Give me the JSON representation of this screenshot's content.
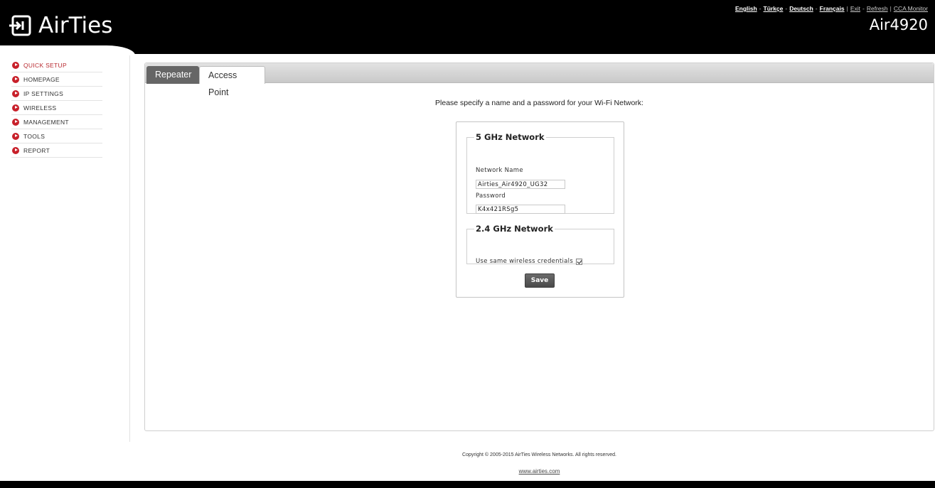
{
  "header": {
    "brand": "AirTies",
    "model": "Air4920",
    "languages": [
      "English",
      "Türkçe",
      "Deutsch",
      "Français"
    ],
    "links": [
      "Exit",
      "Refresh",
      "CCA Monitor"
    ]
  },
  "sidebar": {
    "items": [
      {
        "label": "QUICK SETUP",
        "active": true
      },
      {
        "label": "HOMEPAGE"
      },
      {
        "label": "IP SETTINGS"
      },
      {
        "label": "WIRELESS"
      },
      {
        "label": "MANAGEMENT"
      },
      {
        "label": "TOOLS"
      },
      {
        "label": "REPORT"
      }
    ]
  },
  "tabs": [
    {
      "label": "Repeater"
    },
    {
      "label": "Access Point",
      "selected": true
    }
  ],
  "main": {
    "instruction": "Please specify a name and a password for your Wi-Fi Network:",
    "network_5g": {
      "legend": "5 GHz Network",
      "name_label": "Network Name",
      "name_value": "Airties_Air4920_UG32",
      "password_label": "Password",
      "password_value": "K4x421RSg5"
    },
    "network_24g": {
      "legend": "2.4 GHz Network",
      "same_credentials_label": "Use same wireless credentials",
      "same_credentials_checked": true
    },
    "save_label": "Save"
  },
  "footer": {
    "copyright": "Copyright © 2005-2015 AirTies Wireless Networks. All rights reserved.",
    "website": "www.airties.com"
  },
  "colors": {
    "accent_red": "#c8202a",
    "header_bg": "#000000",
    "active_tab_bg": "#666666"
  }
}
